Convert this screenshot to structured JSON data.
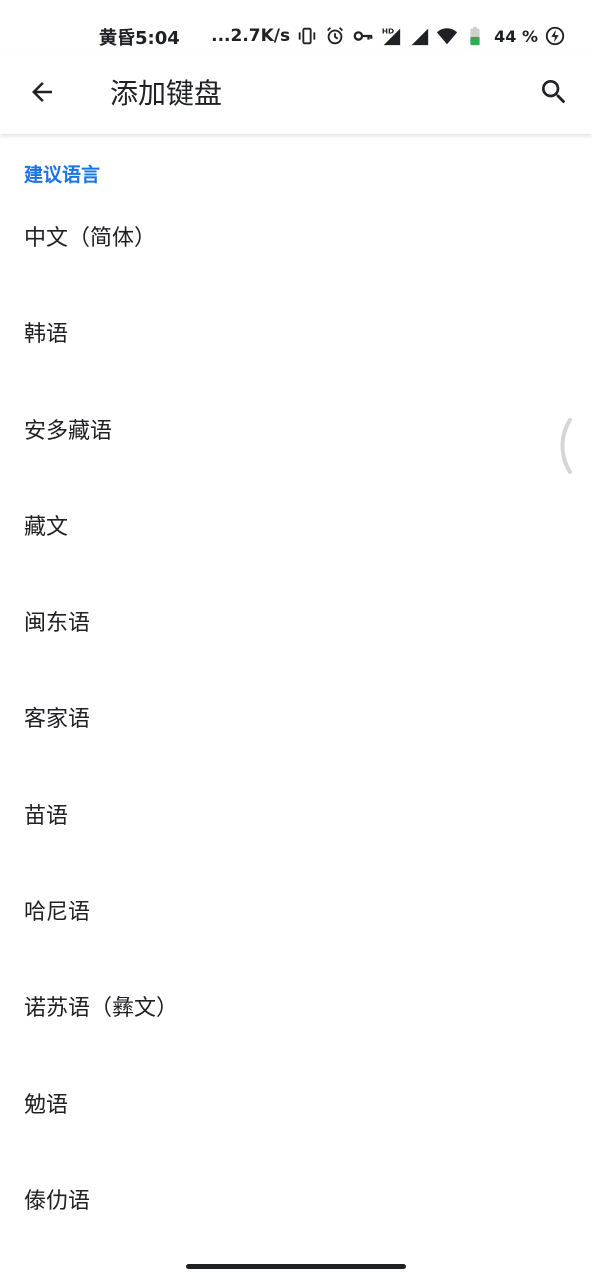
{
  "status_bar": {
    "time": "黄昏5:04",
    "net_speed": "...2.7K/s",
    "battery": "44 %",
    "icons": [
      "vibrate-icon",
      "alarm-icon",
      "vpn-key-icon",
      "hd-signal-icon",
      "signal-icon",
      "wifi-icon",
      "battery-icon",
      "charging-icon"
    ]
  },
  "app_bar": {
    "title": "添加键盘",
    "back_icon": "arrow-back-icon",
    "search_icon": "search-icon"
  },
  "section": {
    "header": "建议语言"
  },
  "languages": [
    "中文（简体）",
    "韩语",
    "安多藏语",
    "藏文",
    "闽东语",
    "客家语",
    "苗语",
    "哈尼语",
    "诺苏语（彝文）",
    "勉语",
    "傣仂语"
  ],
  "colors": {
    "accent": "#1a73e8",
    "text": "#202124",
    "background": "#ffffff"
  }
}
